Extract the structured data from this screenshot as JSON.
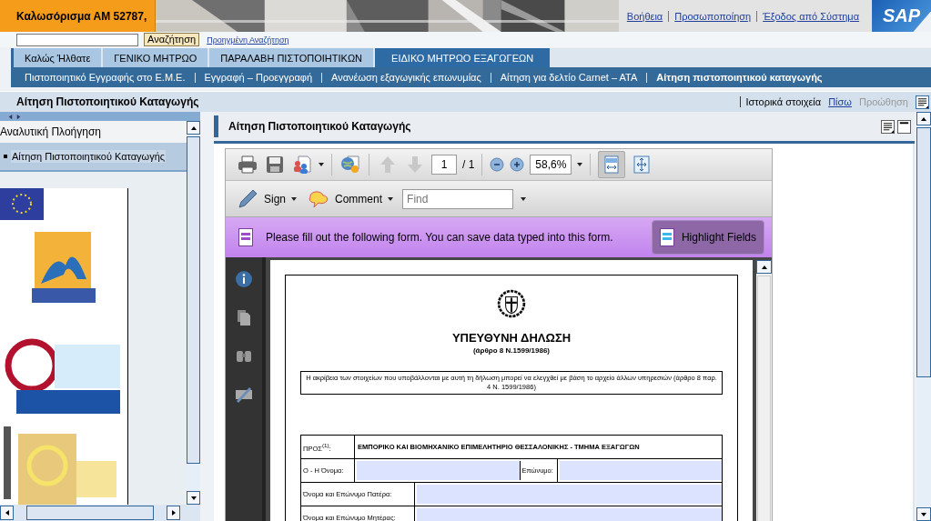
{
  "header": {
    "welcome": "Καλωσόρισμα ΑΜ 52787,",
    "links": [
      "Βοήθεια",
      "Προσωποποίηση",
      "Έξοδος από Σύστημα"
    ],
    "logo": "SAP"
  },
  "search": {
    "button": "Αναζήτηση",
    "advanced_link": "Προηγμένη Αναζήτηση"
  },
  "tabs": [
    {
      "label": "Καλώς Ήλθατε",
      "selected": false
    },
    {
      "label": "ΓΕΝΙΚΟ ΜΗΤΡΩΟ",
      "selected": false
    },
    {
      "label": "ΠΑΡΑΛΑΒΗ ΠΙΣΤΟΠΟΙΗΤΙΚΩΝ",
      "selected": false
    },
    {
      "label": "ΕΙΔΙΚΟ ΜΗΤΡΩΟ ΕΞΑΓΩΓΕΩΝ",
      "selected": true
    }
  ],
  "subnav": [
    {
      "label": "Πιστοποιητικό Εγγραφής στο Ε.Μ.Ε.",
      "selected": false
    },
    {
      "label": "Εγγραφή – Προεγγραφή",
      "selected": false
    },
    {
      "label": "Ανανέωση εξαγωγικής επωνυμίας",
      "selected": false
    },
    {
      "label": "Αίτηση για δελτίο Carnet – ATA",
      "selected": false
    },
    {
      "label": "Αίτηση πιστοποιητικού καταγωγής",
      "selected": true
    }
  ],
  "page_title": "Αίτηση Πιστοποιητικού Καταγωγής",
  "page_actions": [
    {
      "label": "Ιστορικά στοιχεία",
      "kind": "menu",
      "disabled": false
    },
    {
      "label": "Πίσω",
      "kind": "link",
      "disabled": false
    },
    {
      "label": "Προώθηση",
      "kind": "link",
      "disabled": true
    }
  ],
  "navigation": {
    "title": "Αναλυτική Πλοήγηση",
    "items": [
      {
        "label": "Αίτηση Πιστοποιητικού Καταγωγής",
        "selected": true
      }
    ]
  },
  "content": {
    "title": "Αίτηση Πιστοποιητικού Καταγωγής"
  },
  "pdf_viewer": {
    "page_current": "1",
    "page_total": "/ 1",
    "zoom": "58,6%",
    "fit_width_selected": true,
    "sign": "Sign",
    "comment": "Comment",
    "find_placeholder": "Find",
    "form_notice": "Please fill out the following form. You can save data typed into this form.",
    "highlight_button": "Highlight Fields",
    "highlight_fields": true,
    "document": {
      "title": "ΥΠΕΥΘΥΝΗ ΔΗΛΩΣΗ",
      "subtitle": "(άρθρο 8 Ν.1599/1986)",
      "notice": "Η ακρίβεια των στοιχείων που υποβάλλονται με αυτή τη δήλωση μπορεί να ελεγχθεί με βάση το αρχείο άλλων υπηρεσιών (άρθρο 8 παρ. 4 Ν. 1599/1986)",
      "recipient_label": "ΠΡΟΣ$^{(1)}$:",
      "recipient": "ΕΜΠΟΡΙΚΟ ΚΑΙ ΒΙΟΜΗΧΑΝΙΚΟ ΕΠΙΜΕΛΗΤΗΡΙΟ ΘΕΣΣΑΛΟΝΙΚΗΣ - ΤΜΗΜΑ ΕΞΑΓΩΓΩΝ",
      "rows": [
        {
          "fields": [
            {
              "label": "Ο - Η Όνομα:"
            },
            {
              "label": "Επώνυμο:"
            }
          ]
        },
        {
          "fields": [
            {
              "label": "Όνομα και Επώνυμο Πατέρα:"
            }
          ]
        },
        {
          "fields": [
            {
              "label": "Όνομα και Επώνυμο Μητέρας:"
            }
          ]
        }
      ]
    }
  }
}
